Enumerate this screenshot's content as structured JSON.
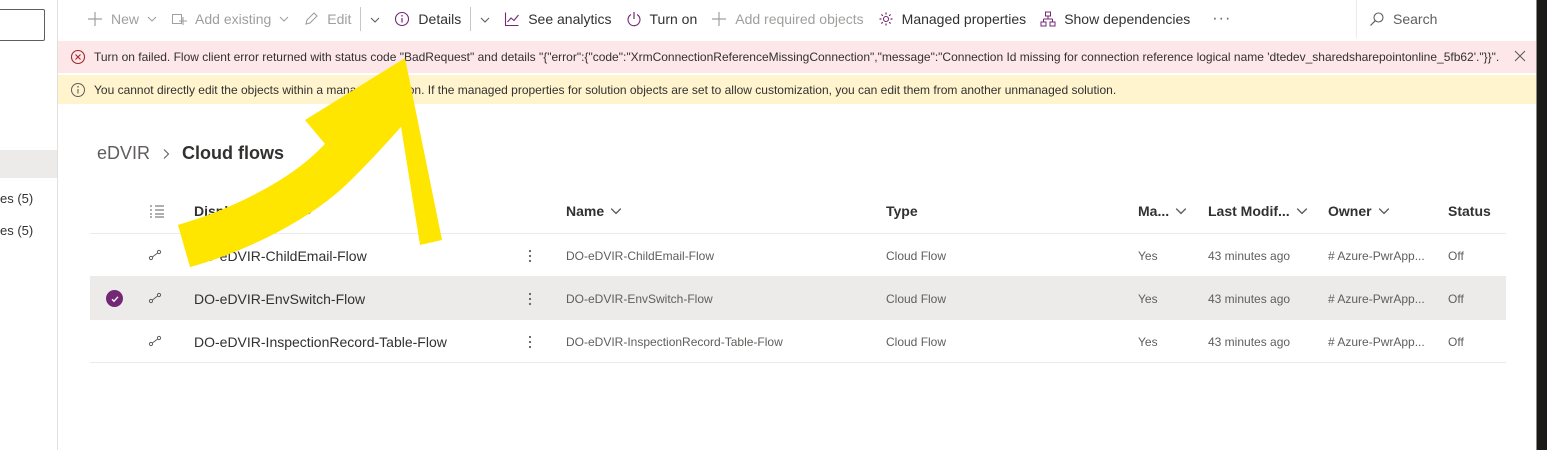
{
  "left_panel": {
    "items": [
      {
        "label": "es (5)"
      },
      {
        "label": "es (5)"
      }
    ]
  },
  "command_bar": {
    "new_label": "New",
    "add_existing_label": "Add existing",
    "edit_label": "Edit",
    "details_label": "Details",
    "see_analytics_label": "See analytics",
    "turn_on_label": "Turn on",
    "add_required_label": "Add required objects",
    "managed_properties_label": "Managed properties",
    "show_dependencies_label": "Show dependencies",
    "more_label": "···",
    "search_label": "Search"
  },
  "messages": {
    "error_text": "Turn on failed. Flow client error returned with status code \"BadRequest\" and details \"{\"error\":{\"code\":\"XrmConnectionReferenceMissingConnection\",\"message\":\"Connection Id missing for connection reference logical name 'dtedev_sharedsharepointonline_5fb62'.\"}}\".",
    "warning_text": "You cannot directly edit the objects within a managed solution. If the managed properties for solution objects are set to allow customization, you can edit them from another unmanaged solution."
  },
  "breadcrumb": {
    "root": "eDVIR",
    "current": "Cloud flows"
  },
  "grid": {
    "columns": {
      "display_name": "Display name",
      "sort_indicator": "↑",
      "name": "Name",
      "type": "Type",
      "managed": "Ma...",
      "last_modified": "Last Modif...",
      "owner": "Owner",
      "status": "Status"
    },
    "rows": [
      {
        "display_name": "DO-eDVIR-ChildEmail-Flow",
        "name": "DO-eDVIR-ChildEmail-Flow",
        "type": "Cloud Flow",
        "managed": "Yes",
        "last_modified": "43 minutes ago",
        "owner": "# Azure-PwrApp...",
        "status": "Off",
        "selected": false
      },
      {
        "display_name": "DO-eDVIR-EnvSwitch-Flow",
        "name": "DO-eDVIR-EnvSwitch-Flow",
        "type": "Cloud Flow",
        "managed": "Yes",
        "last_modified": "43 minutes ago",
        "owner": "# Azure-PwrApp...",
        "status": "Off",
        "selected": true
      },
      {
        "display_name": "DO-eDVIR-InspectionRecord-Table-Flow",
        "name": "DO-eDVIR-InspectionRecord-Table-Flow",
        "type": "Cloud Flow",
        "managed": "Yes",
        "last_modified": "43 minutes ago",
        "owner": "# Azure-PwrApp...",
        "status": "Off",
        "selected": false
      }
    ]
  },
  "colors": {
    "accent": "#742774",
    "error_bg": "#fde7e9",
    "error_icon": "#a4262c",
    "warning_bg": "#fff4ce",
    "annotation": "#ffe600"
  }
}
